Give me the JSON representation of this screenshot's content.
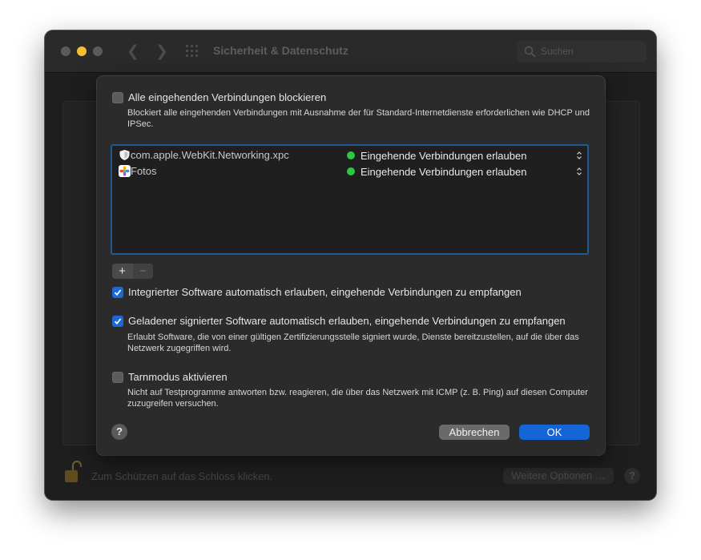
{
  "window": {
    "title": "Sicherheit & Datenschutz",
    "search_placeholder": "Suchen",
    "lock_text": "Zum Schützen auf das Schloss klicken.",
    "more_options_label": "Weitere Optionen …",
    "help_label": "?"
  },
  "sheet": {
    "block_all": {
      "label": "Alle eingehenden Verbindungen blockieren",
      "checked": false,
      "description": "Blockiert alle eingehenden Verbindungen mit Ausnahme der für Standard-Internetdienste erforderlichen wie DHCP und IPSec."
    },
    "apps": [
      {
        "name": "com.apple.WebKit.Networking.xpc",
        "icon": "shield-icon",
        "status": "Eingehende Verbindungen erlauben",
        "status_color": "#2bc840"
      },
      {
        "name": "Fotos",
        "icon": "photos-icon",
        "status": "Eingehende Verbindungen erlauben",
        "status_color": "#2bc840"
      }
    ],
    "add_label": "+",
    "remove_label": "−",
    "builtin": {
      "label": "Integrierter Software automatisch erlauben, eingehende Verbindungen zu empfangen",
      "checked": true
    },
    "signed": {
      "label": "Geladener signierter Software automatisch erlauben, eingehende Verbindungen zu empfangen",
      "checked": true,
      "description": "Erlaubt Software, die von einer gültigen Zertifizierungsstelle signiert wurde, Dienste bereitzustellen, auf die über das Netzwerk zugegriffen wird."
    },
    "stealth": {
      "label": "Tarnmodus aktivieren",
      "checked": false,
      "description": "Nicht auf Testprogramme antworten bzw. reagieren, die über das Netzwerk mit ICMP (z. B. Ping) auf diesen Computer zuzugreifen versuchen."
    },
    "help_label": "?",
    "cancel_label": "Abbrechen",
    "ok_label": "OK"
  },
  "colors": {
    "accent": "#1466d6",
    "status_green": "#2bc840",
    "list_focus_border": "#1f5b93"
  }
}
